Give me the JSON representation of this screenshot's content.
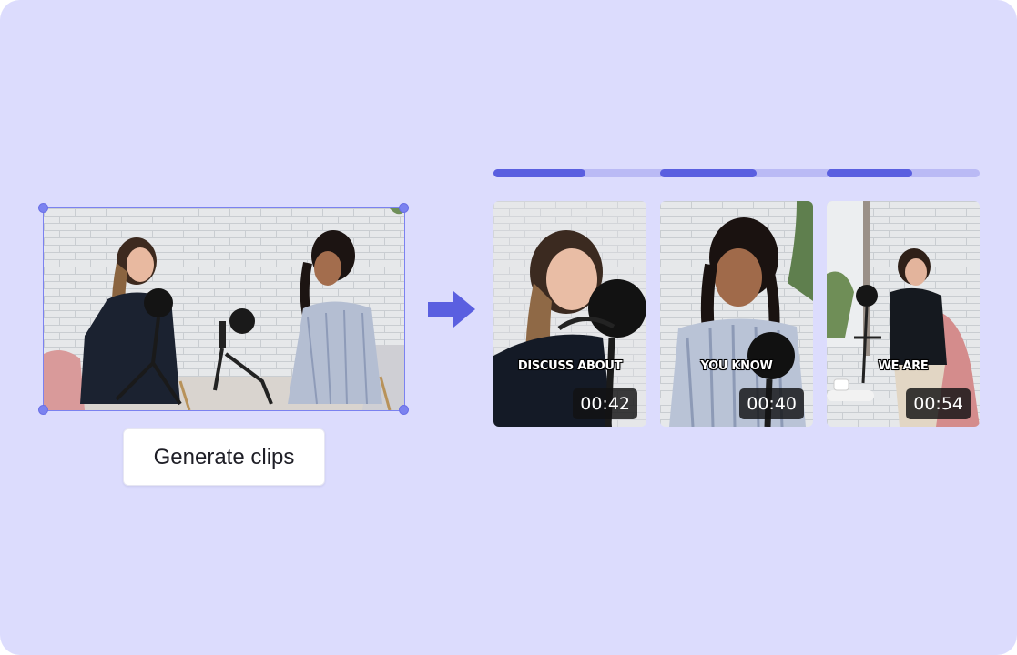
{
  "action": {
    "generate_label": "Generate clips"
  },
  "progress": {
    "segments": [
      0.6,
      0.63,
      0.56
    ]
  },
  "clips": [
    {
      "caption": "DISCUSS ABOUT",
      "duration": "00:42"
    },
    {
      "caption": "YOU KNOW",
      "duration": "00:40"
    },
    {
      "caption": "WE ARE",
      "duration": "00:54"
    }
  ],
  "colors": {
    "background": "#dcdcfd",
    "accent": "#5a5fe0",
    "track": "#babaf5",
    "selection": "#7b82f0"
  },
  "icons": {
    "arrow": "arrow-right-icon"
  }
}
